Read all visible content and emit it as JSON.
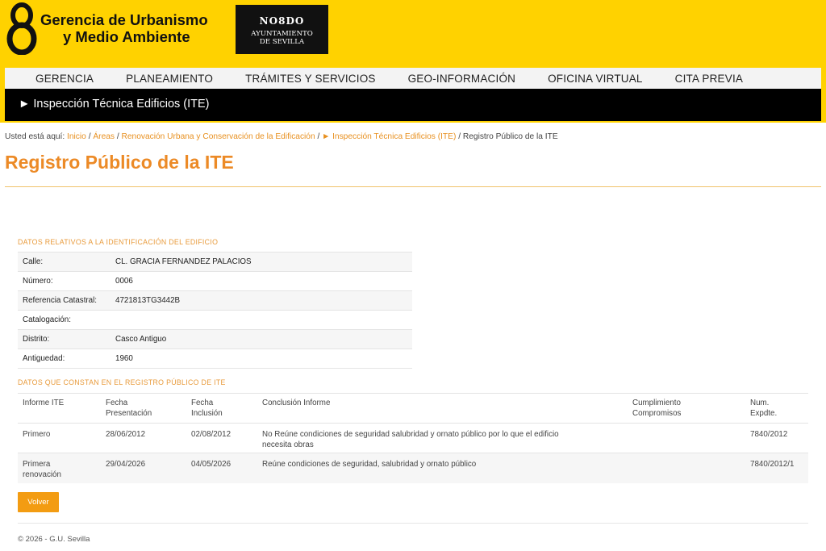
{
  "header": {
    "logo_line1": "Gerencia de Urbanismo",
    "logo_line2": "y Medio Ambiente",
    "nodo_title": "NO8DO",
    "nodo_sub1": "AYUNTAMIENTO",
    "nodo_sub2": "DE SEVILLA",
    "brand_color": "#ffd200"
  },
  "nav": {
    "items": [
      {
        "label": "GERENCIA"
      },
      {
        "label": "PLANEAMIENTO"
      },
      {
        "label": "TRÁMITES Y SERVICIOS"
      },
      {
        "label": "GEO-INFORMACIÓN"
      },
      {
        "label": "OFICINA VIRTUAL"
      },
      {
        "label": "CITA PREVIA"
      }
    ],
    "section_label": "► Inspección Técnica Edificios (ITE)"
  },
  "breadcrumb": {
    "prefix": "Usted está aquí:",
    "links": [
      "Inicio",
      "Áreas",
      "Renovación Urbana y Conservación de la Edificación",
      "► Inspección Técnica Edificios (ITE)"
    ],
    "current": "Registro Público de la ITE",
    "separator": "/"
  },
  "page": {
    "title": "Registro Público de la ITE",
    "accent_color": "#ec8a26"
  },
  "building": {
    "heading": "DATOS RELATIVOS A LA IDENTIFICACIÓN DEL EDIFICIO",
    "rows": [
      {
        "label": "Calle:",
        "value": "CL. GRACIA FERNANDEZ PALACIOS"
      },
      {
        "label": "Número:",
        "value": "0006"
      },
      {
        "label": "Referencia Catastral:",
        "value": "4721813TG3442B"
      },
      {
        "label": "Catalogación:",
        "value": ""
      },
      {
        "label": "Distrito:",
        "value": "Casco Antiguo"
      },
      {
        "label": "Antiguedad:",
        "value": "1960"
      }
    ]
  },
  "registry": {
    "heading": "DATOS QUE CONSTAN EN EL REGISTRO PÚBLICO DE ITE",
    "columns": [
      {
        "l1": "Informe ITE",
        "l2": ""
      },
      {
        "l1": "Fecha",
        "l2": "Presentación"
      },
      {
        "l1": "Fecha",
        "l2": "Inclusión"
      },
      {
        "l1": "Conclusión Informe",
        "l2": ""
      },
      {
        "l1": "Cumplimiento",
        "l2": "Compromisos"
      },
      {
        "l1": "Num.",
        "l2": "Expdte."
      }
    ],
    "rows": [
      {
        "informe_l1": "Primero",
        "informe_l2": "",
        "presentacion": "28/06/2012",
        "inclusion": "02/08/2012",
        "conclusion_l1": "No Reúne condiciones de seguridad salubridad y ornato público por lo que el edificio",
        "conclusion_l2": "necesita obras",
        "cumplimiento": "",
        "expediente": "7840/2012"
      },
      {
        "informe_l1": "Primera",
        "informe_l2": "renovación",
        "presentacion": "29/04/2026",
        "inclusion": "04/05/2026",
        "conclusion_l1": "Reúne condiciones de seguridad, salubridad y ornato público",
        "conclusion_l2": "",
        "cumplimiento": "",
        "expediente": "7840/2012/1"
      }
    ]
  },
  "actions": {
    "volver_label": "Volver"
  },
  "footer": {
    "text": "© 2026 - G.U. Sevilla"
  }
}
